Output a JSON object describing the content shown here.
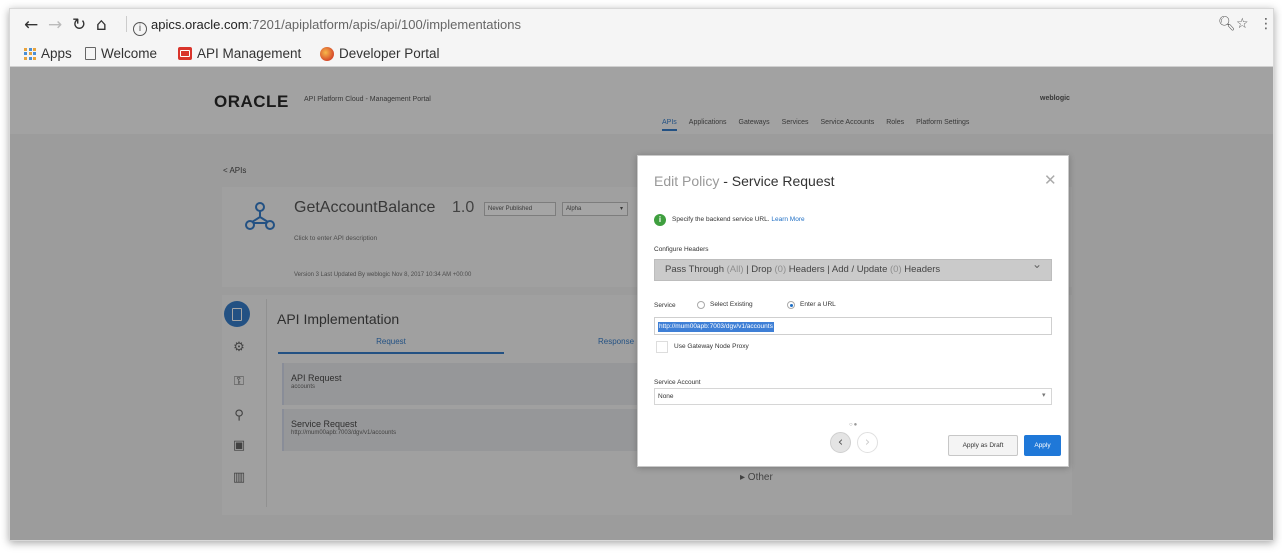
{
  "browser": {
    "url_host": "apics.oracle.com",
    "url_path": ":7201/apiplatform/apis/api/100/implementations",
    "bookmarks": [
      "Apps",
      "Welcome",
      "API Management",
      "Developer Portal"
    ]
  },
  "portal": {
    "logo": "ORACLE",
    "subtitle": "API Platform Cloud - Management Portal",
    "user": "weblogic",
    "nav": [
      "APIs",
      "Applications",
      "Gateways",
      "Services",
      "Service Accounts",
      "Roles",
      "Platform Settings"
    ]
  },
  "api": {
    "back_label": "< APIs",
    "name": "GetAccountBalance",
    "version": "1.0",
    "publish_state": "Never Published",
    "stage": "Alpha",
    "description_placeholder": "Click to enter API description",
    "meta": "Version 3   Last Updated By   weblogic   Nov 8, 2017 10:34 AM +00:00"
  },
  "implementation": {
    "title": "API Implementation",
    "tab_request": "Request",
    "tab_response": "Response",
    "rows": [
      {
        "title": "API Request",
        "sub": "accounts"
      },
      {
        "title": "Service Request",
        "sub": "http://mum00apb:7003/dgv/v1/accounts"
      }
    ],
    "other_link": "▸ Other"
  },
  "modal": {
    "title_prefix": "Edit Policy",
    "title_main": " - Service Request",
    "hint": "Specify the backend service URL.",
    "learn_more": "Learn More",
    "configure_headers_label": "Configure Headers",
    "headers": {
      "pass_through": "Pass Through",
      "pass_through_count": "(All)",
      "drop": "| Drop",
      "drop_count": "(0)",
      "headers_word": "Headers | Add / Update",
      "update_count": "(0)",
      "tail": "Headers"
    },
    "service_label": "Service",
    "radio_select_existing": "Select Existing",
    "radio_enter_url": "Enter a URL",
    "service_url": "http://mum00apb:7003/dgv/v1/accounts",
    "use_gateway_proxy": "Use Gateway Node Proxy",
    "service_account_label": "Service Account",
    "service_account_value": "None",
    "apply_draft": "Apply as Draft",
    "apply": "Apply"
  }
}
